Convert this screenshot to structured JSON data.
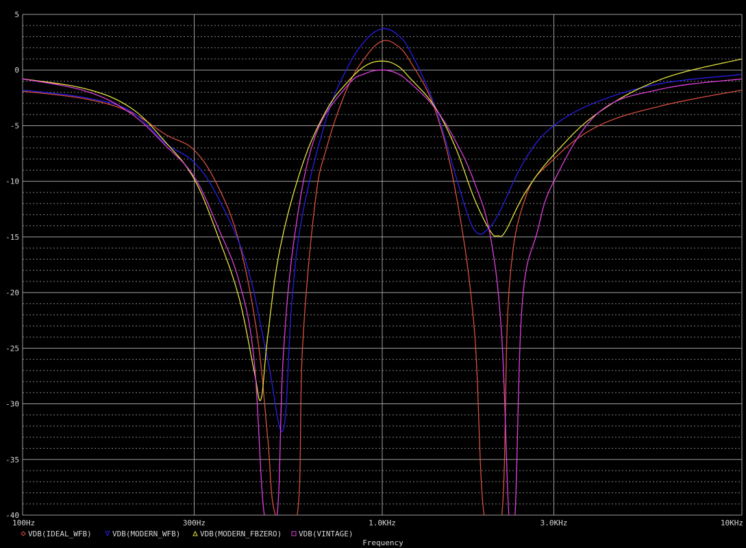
{
  "chart_data": {
    "type": "line",
    "xlabel": "Frequency",
    "ylabel": "",
    "x_scale": "log",
    "xlim": [
      100,
      10000
    ],
    "ylim": [
      -40,
      5
    ],
    "x_ticks": [
      {
        "value": 100,
        "label": "100Hz"
      },
      {
        "value": 300,
        "label": "300Hz"
      },
      {
        "value": 1000,
        "label": "1.0KHz"
      },
      {
        "value": 3000,
        "label": "3.0KHz"
      },
      {
        "value": 10000,
        "label": "10KHz"
      }
    ],
    "y_ticks": [
      {
        "value": 5,
        "label": "5"
      },
      {
        "value": 0,
        "label": "0"
      },
      {
        "value": -5,
        "label": "-5"
      },
      {
        "value": -10,
        "label": "-10"
      },
      {
        "value": -15,
        "label": "-15"
      },
      {
        "value": -20,
        "label": "-20"
      },
      {
        "value": -25,
        "label": "-25"
      },
      {
        "value": -30,
        "label": "-30"
      },
      {
        "value": -35,
        "label": "-35"
      },
      {
        "value": -40,
        "label": "-40"
      }
    ],
    "grid": true,
    "legend_position": "bottom-left",
    "background": "#000000",
    "grid_color": "#b0b0b0",
    "series": [
      {
        "name": "VDB(IDEAL_WFB)",
        "color": "#d85040",
        "marker": "diamond",
        "points": [
          [
            100,
            -1.9
          ],
          [
            150,
            -2.6
          ],
          [
            200,
            -3.8
          ],
          [
            250,
            -5.8
          ],
          [
            300,
            -7.2
          ],
          [
            350,
            -10.5
          ],
          [
            400,
            -15.5
          ],
          [
            450,
            -24
          ],
          [
            480,
            -33
          ],
          [
            505,
            -40
          ],
          [
            580,
            -40
          ],
          [
            600,
            -25
          ],
          [
            650,
            -12
          ],
          [
            700,
            -7
          ],
          [
            800,
            -1.6
          ],
          [
            900,
            1.2
          ],
          [
            1000,
            2.6
          ],
          [
            1100,
            2.2
          ],
          [
            1200,
            0.7
          ],
          [
            1400,
            -3.5
          ],
          [
            1600,
            -11
          ],
          [
            1800,
            -23
          ],
          [
            1920,
            -40
          ],
          [
            2150,
            -40
          ],
          [
            2250,
            -20
          ],
          [
            2500,
            -11.5
          ],
          [
            3000,
            -8
          ],
          [
            4000,
            -5
          ],
          [
            6000,
            -3.2
          ],
          [
            10000,
            -1.8
          ]
        ]
      },
      {
        "name": "VDB(MODERN_WFB)",
        "color": "#2a1ee6",
        "marker": "triangle-down",
        "points": [
          [
            100,
            -1.8
          ],
          [
            150,
            -2.5
          ],
          [
            200,
            -3.7
          ],
          [
            250,
            -6.6
          ],
          [
            300,
            -8.3
          ],
          [
            350,
            -11.5
          ],
          [
            420,
            -17.5
          ],
          [
            480,
            -26
          ],
          [
            530,
            -32.4
          ],
          [
            560,
            -21
          ],
          [
            600,
            -13
          ],
          [
            700,
            -4.3
          ],
          [
            800,
            0.2
          ],
          [
            900,
            2.7
          ],
          [
            1000,
            3.7
          ],
          [
            1100,
            3.2
          ],
          [
            1200,
            1.6
          ],
          [
            1400,
            -3.2
          ],
          [
            1600,
            -9.5
          ],
          [
            1750,
            -13.5
          ],
          [
            1850,
            -14.7
          ],
          [
            1950,
            -14.4
          ],
          [
            2100,
            -13
          ],
          [
            2500,
            -8
          ],
          [
            3000,
            -5
          ],
          [
            4000,
            -2.8
          ],
          [
            6000,
            -1.2
          ],
          [
            10000,
            -0.4
          ]
        ]
      },
      {
        "name": "VDB(MODERN_FBZERO)",
        "color": "#e6e640",
        "marker": "triangle-up",
        "points": [
          [
            100,
            -0.8
          ],
          [
            150,
            -1.7
          ],
          [
            200,
            -3.4
          ],
          [
            250,
            -6.5
          ],
          [
            300,
            -9.8
          ],
          [
            350,
            -15
          ],
          [
            400,
            -20.5
          ],
          [
            440,
            -27
          ],
          [
            460,
            -29.6
          ],
          [
            480,
            -24
          ],
          [
            520,
            -16
          ],
          [
            600,
            -8.5
          ],
          [
            700,
            -3.6
          ],
          [
            800,
            -1.1
          ],
          [
            900,
            0.4
          ],
          [
            1000,
            0.8
          ],
          [
            1100,
            0.4
          ],
          [
            1200,
            -0.8
          ],
          [
            1400,
            -3.3
          ],
          [
            1600,
            -7
          ],
          [
            1800,
            -11.5
          ],
          [
            2000,
            -14.5
          ],
          [
            2100,
            -14.9
          ],
          [
            2200,
            -14.5
          ],
          [
            2500,
            -11
          ],
          [
            3000,
            -7.6
          ],
          [
            4000,
            -3.8
          ],
          [
            6000,
            -0.8
          ],
          [
            10000,
            1.0
          ]
        ]
      },
      {
        "name": "VDB(VINTAGE)",
        "color": "#e040e0",
        "marker": "square",
        "points": [
          [
            100,
            -0.8
          ],
          [
            150,
            -1.9
          ],
          [
            200,
            -3.9
          ],
          [
            250,
            -6.8
          ],
          [
            300,
            -9.6
          ],
          [
            350,
            -14.2
          ],
          [
            400,
            -19
          ],
          [
            440,
            -26
          ],
          [
            470,
            -40
          ],
          [
            510,
            -40
          ],
          [
            530,
            -26
          ],
          [
            570,
            -15
          ],
          [
            650,
            -6
          ],
          [
            800,
            -1.4
          ],
          [
            900,
            -0.3
          ],
          [
            1000,
            0
          ],
          [
            1100,
            -0.3
          ],
          [
            1200,
            -1.2
          ],
          [
            1400,
            -3.4
          ],
          [
            1600,
            -6.4
          ],
          [
            1800,
            -10
          ],
          [
            2000,
            -15
          ],
          [
            2150,
            -24
          ],
          [
            2250,
            -40
          ],
          [
            2340,
            -40
          ],
          [
            2450,
            -21
          ],
          [
            2700,
            -14.5
          ],
          [
            3000,
            -10
          ],
          [
            4000,
            -3.8
          ],
          [
            6000,
            -1.7
          ],
          [
            10000,
            -0.8
          ]
        ]
      }
    ]
  }
}
